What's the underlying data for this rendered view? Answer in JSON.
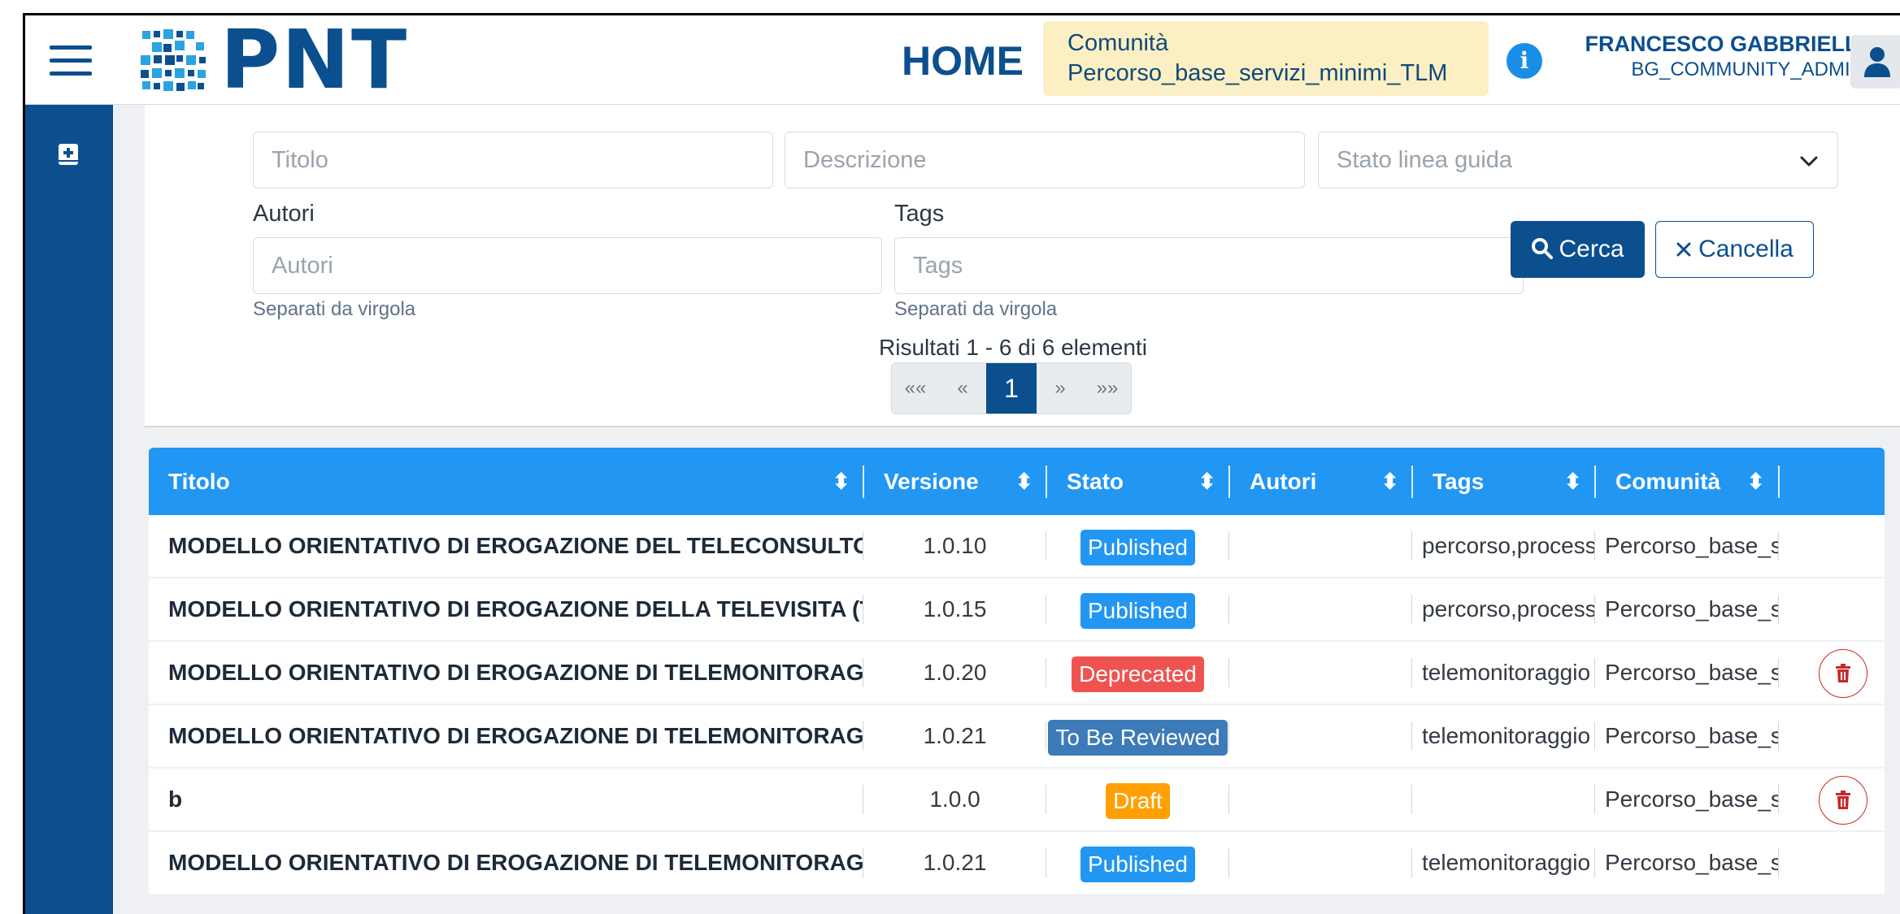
{
  "header": {
    "logo_text": "PNT",
    "home_label": "HOME",
    "community_label": "Comunità",
    "community_value": "Percorso_base_servizi_minimi_TLM",
    "user_name": "FRANCESCO GABBRIELLI",
    "user_role": "BG_COMMUNITY_ADMIN",
    "info_glyph": "i"
  },
  "filters": {
    "titolo_placeholder": "Titolo",
    "descrizione_placeholder": "Descrizione",
    "stato_placeholder": "Stato linea guida",
    "autori_label": "Autori",
    "autori_placeholder": "Autori",
    "autori_hint": "Separati da virgola",
    "tags_label": "Tags",
    "tags_placeholder": "Tags",
    "tags_hint": "Separati da virgola",
    "search_label": "Cerca",
    "cancel_label": "Cancella"
  },
  "pagination": {
    "results_text": "Risultati  1 -  6 di 6 elementi",
    "first": "««",
    "prev": "«",
    "current": "1",
    "next": "»",
    "last": "»»"
  },
  "table": {
    "columns": [
      "Titolo",
      "Versione",
      "Stato",
      "Autori",
      "Tags",
      "Comunità"
    ],
    "sort_glyph": "⬍",
    "rows": [
      {
        "title": "MODELLO ORIENTATIVO DI EROGAZIONE DEL TELECONSULTO (",
        "version": "1.0.10",
        "status": "Published",
        "authors": "",
        "tags": "percorso,processo",
        "community": "Percorso_base_servizi",
        "deletable": false
      },
      {
        "title": "MODELLO ORIENTATIVO DI EROGAZIONE DELLA TELEVISITA (T",
        "version": "1.0.15",
        "status": "Published",
        "authors": "",
        "tags": "percorso,processo",
        "community": "Percorso_base_servizi",
        "deletable": false
      },
      {
        "title": "MODELLO ORIENTATIVO DI EROGAZIONE DI TELEMONITORAGGIO",
        "version": "1.0.20",
        "status": "Deprecated",
        "authors": "",
        "tags": "telemonitoraggio",
        "community": "Percorso_base_servizi",
        "deletable": true
      },
      {
        "title": "MODELLO ORIENTATIVO DI EROGAZIONE DI TELEMONITORAGGIO",
        "version": "1.0.21",
        "status": "To Be Reviewed",
        "authors": "",
        "tags": "telemonitoraggio",
        "community": "Percorso_base_servizi",
        "deletable": false
      },
      {
        "title": "b",
        "version": "1.0.0",
        "status": "Draft",
        "authors": "",
        "tags": "",
        "community": "Percorso_base_servizi",
        "deletable": true
      },
      {
        "title": "MODELLO ORIENTATIVO DI EROGAZIONE DI TELEMONITORAGGIO",
        "version": "1.0.21",
        "status": "Published",
        "authors": "",
        "tags": "telemonitoraggio",
        "community": "Percorso_base_servizi",
        "deletable": false
      }
    ]
  },
  "status_colors": {
    "Published": "#2196f3",
    "Deprecated": "#ef5350",
    "To Be Reviewed": "#3d7ab8",
    "Draft": "#ffa000"
  },
  "icons": {
    "menu": "hamburger-icon",
    "info": "info-icon",
    "user": "user-icon",
    "rail": "add-book-icon",
    "search": "search-icon",
    "cancel": "close-icon",
    "select": "chevron-down-icon",
    "delete": "trash-icon"
  }
}
